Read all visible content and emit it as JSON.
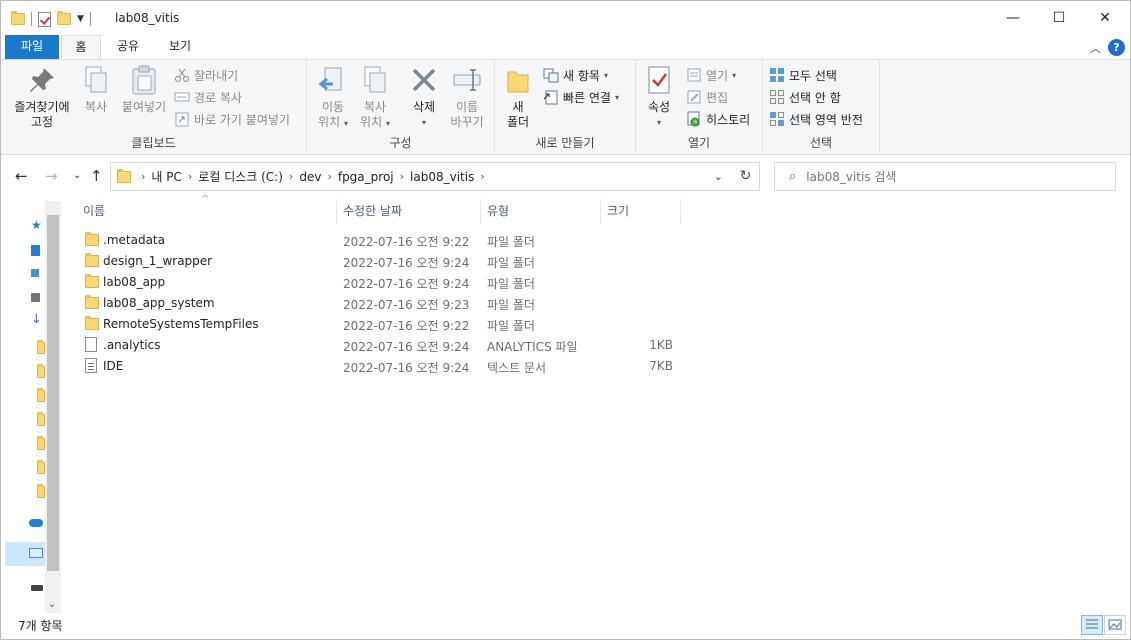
{
  "window": {
    "title": "lab08_vitis",
    "controls": {
      "minimize": "—",
      "maximize": "☐",
      "close": "✕"
    }
  },
  "tabs": [
    "파일",
    "홈",
    "공유",
    "보기"
  ],
  "ribbon": {
    "clipboard": {
      "label": "클립보드",
      "pin": [
        "즐겨찾기에",
        "고정"
      ],
      "copy": "복사",
      "paste": "붙여넣기",
      "cut": "잘라내기",
      "copy_path": "경로 복사",
      "paste_shortcut": "바로 가기 붙여넣기"
    },
    "organize": {
      "label": "구성",
      "move_to": [
        "이동",
        "위치"
      ],
      "copy_to": [
        "복사",
        "위치"
      ],
      "delete": "삭제",
      "rename": [
        "이름",
        "바꾸기"
      ]
    },
    "new": {
      "label": "새로 만들기",
      "new_folder": [
        "새",
        "폴더"
      ],
      "new_item": "새 항목",
      "easy_access": "빠른 연결"
    },
    "open": {
      "label": "열기",
      "properties": "속성",
      "open": "열기",
      "edit": "편집",
      "history": "히스토리"
    },
    "select": {
      "label": "선택",
      "select_all": "모두 선택",
      "select_none": "선택 안 함",
      "invert": "선택 영역 반전"
    }
  },
  "address": {
    "crumbs": [
      "내 PC",
      "로컬 디스크 (C:)",
      "dev",
      "fpga_proj",
      "lab08_vitis"
    ],
    "search_placeholder": "lab08_vitis 검색"
  },
  "columns": {
    "name": "이름",
    "date": "수정한 날짜",
    "type": "유형",
    "size": "크기"
  },
  "files": [
    {
      "name": ".metadata",
      "date": "2022-07-16 오전 9:22",
      "type": "파일 폴더",
      "size": "",
      "kind": "folder"
    },
    {
      "name": "design_1_wrapper",
      "date": "2022-07-16 오전 9:24",
      "type": "파일 폴더",
      "size": "",
      "kind": "folder"
    },
    {
      "name": "lab08_app",
      "date": "2022-07-16 오전 9:24",
      "type": "파일 폴더",
      "size": "",
      "kind": "folder"
    },
    {
      "name": "lab08_app_system",
      "date": "2022-07-16 오전 9:23",
      "type": "파일 폴더",
      "size": "",
      "kind": "folder"
    },
    {
      "name": "RemoteSystemsTempFiles",
      "date": "2022-07-16 오전 9:22",
      "type": "파일 폴더",
      "size": "",
      "kind": "folder"
    },
    {
      "name": ".analytics",
      "date": "2022-07-16 오전 9:24",
      "type": "ANALYTICS 파일",
      "size": "1KB",
      "kind": "file"
    },
    {
      "name": "IDE",
      "date": "2022-07-16 오전 9:24",
      "type": "텍스트 문서",
      "size": "7KB",
      "kind": "text"
    }
  ],
  "status": {
    "item_count": "7개 항목"
  },
  "colors": {
    "accent": "#1979ca",
    "folder": "#f8d775",
    "help": "#1f6fce"
  }
}
